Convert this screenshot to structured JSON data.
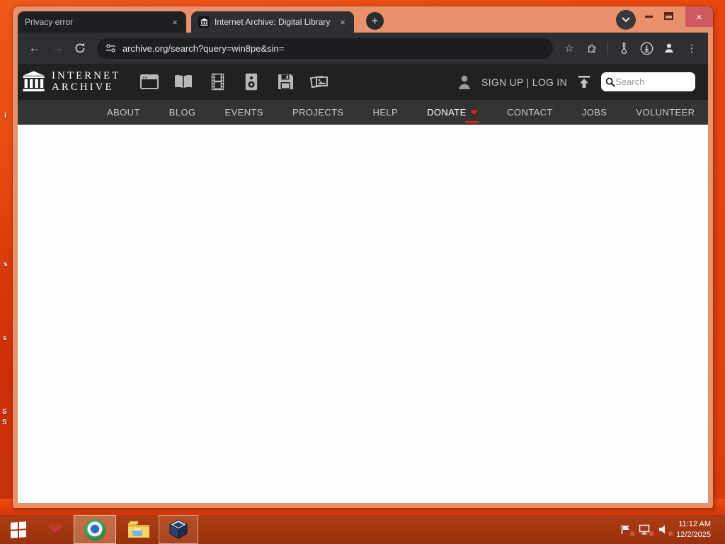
{
  "browser": {
    "tabs": [
      {
        "title": "Privacy error"
      },
      {
        "title": "Internet Archive: Digital Library"
      }
    ],
    "url": "archive.org/search?query=win8pe&sin="
  },
  "icons": {
    "close_x": "×",
    "plus": "+",
    "back_arrow": "←",
    "forward_arrow": "→",
    "star": "☆",
    "dots_menu": "⋮",
    "heart": "❤"
  },
  "archive_header": {
    "logo_line1": "INTERNET",
    "logo_line2": "ARCHIVE",
    "auth": "SIGN UP | LOG IN",
    "search_placeholder": "Search"
  },
  "nav_items": [
    {
      "label": "ABOUT"
    },
    {
      "label": "BLOG"
    },
    {
      "label": "EVENTS"
    },
    {
      "label": "PROJECTS"
    },
    {
      "label": "HELP"
    },
    {
      "label": "DONATE"
    },
    {
      "label": "CONTACT"
    },
    {
      "label": "JOBS"
    },
    {
      "label": "VOLUNTEER"
    }
  ],
  "desktop": {
    "fragments": {
      "f1": "i",
      "f2": "s",
      "f3": "s",
      "f4": "S",
      "f5": "S"
    }
  },
  "taskbar": {
    "time": "11:12 AM",
    "date": "12/2/2025"
  },
  "colors": {
    "frame": "#e8916b",
    "close_button": "#cd5a5f",
    "desktop": "#e8470e",
    "donate_red": "#cf271c"
  }
}
